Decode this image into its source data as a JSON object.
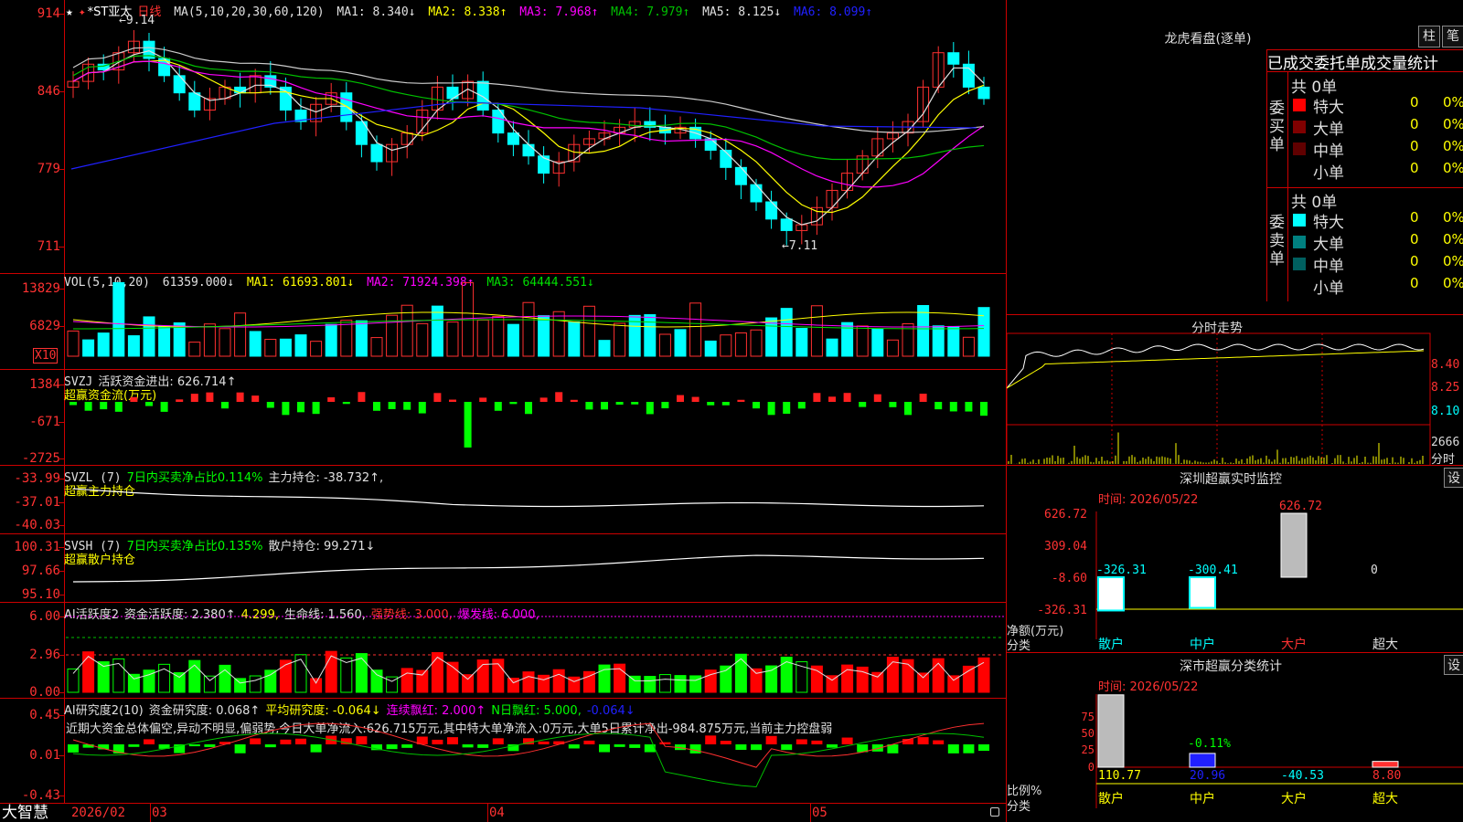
{
  "stock": {
    "star": "★",
    "sep": "✦",
    "name": "*ST亚太",
    "period": "日线",
    "ma_header": "MA(5,10,20,30,60,120)",
    "ma": [
      {
        "label": "MA1: 8.340↓",
        "color": "#e0e0e0"
      },
      {
        "label": "MA2: 8.338↑",
        "color": "#ffff00"
      },
      {
        "label": "MA3: 7.968↑",
        "color": "#ff00ff"
      },
      {
        "label": "MA4: 7.979↑",
        "color": "#00c000"
      },
      {
        "label": "MA5: 8.125↓",
        "color": "#e0e0e0"
      },
      {
        "label": "MA6: 8.099↑",
        "color": "#2020ff"
      }
    ],
    "high_label": "9.14",
    "low_label": "←7.11",
    "high_mark": "←",
    "price_ticks": [
      "914",
      "846",
      "779",
      "711"
    ]
  },
  "volume": {
    "header": "VOL(5,10,20)",
    "value": "61359.000↓",
    "ma": [
      {
        "label": "MA1: 61693.801↓",
        "color": "#ffff00"
      },
      {
        "label": "MA2: 71924.398↑",
        "color": "#ff00ff"
      },
      {
        "label": "MA3: 64444.551↓",
        "color": "#00e000"
      }
    ],
    "ticks": [
      "13829",
      "6829"
    ],
    "unit": "X10"
  },
  "svzj": {
    "header": "SVZJ",
    "label": "活跃资金进出: 626.714↑",
    "sub": "超赢资金流(万元)",
    "ticks": [
      "1384",
      "-671",
      "-2725"
    ]
  },
  "svzl": {
    "header": "SVZL (7)",
    "green_text": "7日内买卖净占比0.114%",
    "value": "主力持仓: -38.732↑,",
    "sub": "超赢主力持仓",
    "ticks": [
      "-33.99",
      "-37.01",
      "-40.03"
    ]
  },
  "svsh": {
    "header": "SVSH (7)",
    "green_text": "7日内买卖净占比0.135%",
    "value": "散户持仓: 99.271↓",
    "sub": "超赢散户持仓",
    "ticks": [
      "100.31",
      "97.66",
      "95.10"
    ]
  },
  "ai1": {
    "header": "AI活跃度2",
    "items": [
      {
        "label": "资金活跃度: 2.380↑",
        "color": "#e0e0e0"
      },
      {
        "label": "4.299,",
        "color": "#ffff00"
      },
      {
        "label": "生命线: 1.560,",
        "color": "#e0e0e0"
      },
      {
        "label": "强势线: 3.000,",
        "color": "#ff3030"
      },
      {
        "label": "爆发线: 6.000,",
        "color": "#ff00ff"
      }
    ],
    "ticks": [
      "6.00",
      "2.96",
      "0.00"
    ]
  },
  "ai2": {
    "header": "AI研究度2(10)",
    "items": [
      {
        "label": "资金研究度: 0.068↑",
        "color": "#e0e0e0"
      },
      {
        "label": "平均研究度: -0.064↓",
        "color": "#ffff00"
      },
      {
        "label": "连续飘红: 2.000↑",
        "color": "#ff00ff"
      },
      {
        "label": "N日飘红: 5.000,",
        "color": "#00ff00"
      },
      {
        "label": "-0.064↓",
        "color": "#2020ff"
      }
    ],
    "comment": "近期大资金总体偏空,异动不明显,偏弱势,今日大单净流入:626.715万元,其中特大单净流入:0万元,大单5日累计净出-984.875万元,当前主力控盘弱",
    "ticks": [
      "0.45",
      "0.01",
      "-0.43"
    ]
  },
  "timeline": {
    "brand": "大智慧",
    "labels": [
      "2026/02",
      "03",
      "04",
      "05"
    ]
  },
  "lhb": {
    "title": "龙虎看盘(逐单)",
    "btn1": "柱",
    "btn2": "笔",
    "tabs": "已成交委托单成交量统计",
    "buy_side": "委买单",
    "sell_side": "委卖单",
    "buy_total": "共 0单",
    "sell_total": "共 0单",
    "buy_rows": [
      {
        "name": "特大",
        "count": "0",
        "pct": "0%",
        "color": "#ff0000"
      },
      {
        "name": "大单",
        "count": "0",
        "pct": "0%",
        "color": "#800000"
      },
      {
        "name": "中单",
        "count": "0",
        "pct": "0%",
        "color": "#600000"
      },
      {
        "name": "小单",
        "count": "0",
        "pct": "0%",
        "color": ""
      }
    ],
    "sell_rows": [
      {
        "name": "特大",
        "count": "0",
        "pct": "0%",
        "color": "#00ffff"
      },
      {
        "name": "大单",
        "count": "0",
        "pct": "0%",
        "color": "#008080"
      },
      {
        "name": "中单",
        "count": "0",
        "pct": "0%",
        "color": "#006060"
      },
      {
        "name": "小单",
        "count": "0",
        "pct": "0%",
        "color": ""
      }
    ]
  },
  "intraday": {
    "title": "分时走势",
    "ticks": [
      "8.40",
      "8.25",
      "8.10"
    ],
    "vol_tick": "2666",
    "vol_label": "分时"
  },
  "monitor": {
    "title": "深圳超赢实时监控",
    "btn": "设",
    "time": "时间: 2026/05/22",
    "yticks": [
      "626.72",
      "309.04",
      "-8.60",
      "-326.31"
    ],
    "ylabel": "净额(万元)",
    "xlabel": "分类",
    "cats": [
      "散户",
      "中户",
      "大户",
      "超大"
    ],
    "values": [
      -326.31,
      -300.41,
      626.72,
      0
    ],
    "value_labels": [
      "-326.31",
      "-300.41",
      "626.72",
      "0"
    ]
  },
  "classify": {
    "title": "深市超赢分类统计",
    "btn": "设",
    "time": "时间: 2026/05/22",
    "yticks": [
      "75",
      "50",
      "25",
      "0"
    ],
    "ylabel": "比例%",
    "xlabel": "分类",
    "cats": [
      "散户",
      "中户",
      "大户",
      "超大"
    ],
    "values": [
      110.77,
      20.96,
      -40.53,
      8.8
    ],
    "value_labels": [
      "110.77",
      "20.96",
      "-40.53",
      "8.80"
    ],
    "note": "-0.11%"
  }
}
